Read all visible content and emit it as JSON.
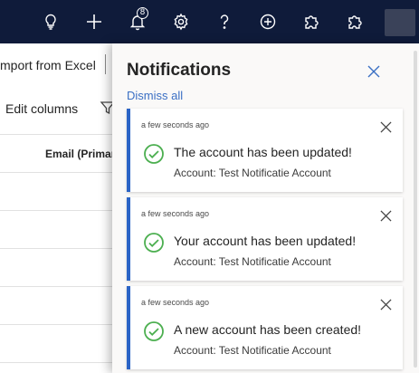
{
  "topbar": {
    "icons": [
      {
        "name": "lightbulb-icon"
      },
      {
        "name": "plus-icon"
      },
      {
        "name": "bell-icon",
        "badge": "8"
      },
      {
        "name": "gear-icon"
      },
      {
        "name": "help-icon"
      },
      {
        "name": "add-circle-icon"
      },
      {
        "name": "puzzle-icon"
      },
      {
        "name": "puzzle-icon"
      }
    ],
    "background_color": "#0f1b3a"
  },
  "background": {
    "import_label": "mport from Excel",
    "edit_columns_label": "Edit columns",
    "column_header": "Email (Primar"
  },
  "notifications": {
    "title": "Notifications",
    "dismiss_all": "Dismiss all",
    "accent_color": "#2b64c6",
    "success_color": "#4caf50",
    "items": [
      {
        "time": "a few seconds ago",
        "title": "The account has been updated!",
        "subtitle": "Account: Test Notificatie Account"
      },
      {
        "time": "a few seconds ago",
        "title": "Your account has been updated!",
        "subtitle": "Account: Test Notificatie Account"
      },
      {
        "time": "a few seconds ago",
        "title": "A new account has been created!",
        "subtitle": "Account: Test Notificatie Account"
      }
    ]
  }
}
